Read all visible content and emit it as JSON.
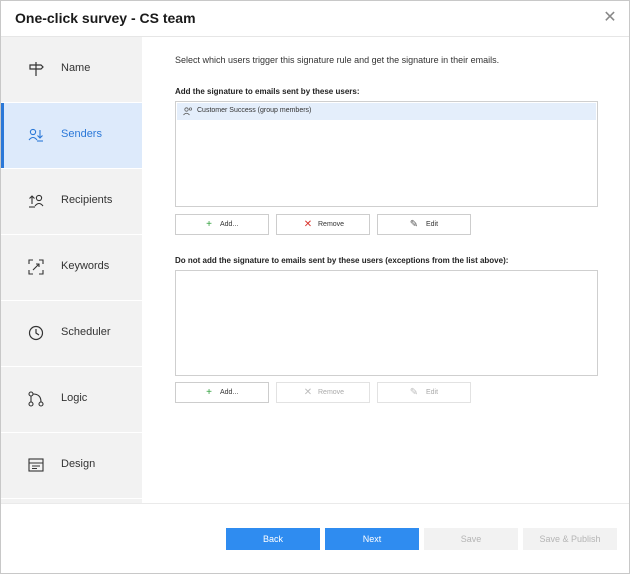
{
  "dialog": {
    "title": "One-click survey - CS team",
    "close_glyph": "✕"
  },
  "sidebar": {
    "items": [
      {
        "label": "Name",
        "icon": "signpost-icon",
        "active": false
      },
      {
        "label": "Senders",
        "icon": "users-icon",
        "active": true
      },
      {
        "label": "Recipients",
        "icon": "recipients-icon",
        "active": false
      },
      {
        "label": "Keywords",
        "icon": "keywords-icon",
        "active": false
      },
      {
        "label": "Scheduler",
        "icon": "clock-icon",
        "active": false
      },
      {
        "label": "Logic",
        "icon": "flow-icon",
        "active": false
      },
      {
        "label": "Design",
        "icon": "design-icon",
        "active": false
      }
    ]
  },
  "main": {
    "intro": "Select which users trigger this signature rule and get the signature in their emails.",
    "include": {
      "heading": "Add the signature to emails sent by these users:",
      "items": [
        "Customer Success (group members)"
      ],
      "buttons": {
        "add": "Add...",
        "remove": "Remove",
        "edit": "Edit"
      }
    },
    "exclude": {
      "heading": "Do not add the signature to emails sent by these users (exceptions from the list above):",
      "items": [],
      "buttons": {
        "add": "Add...",
        "remove": "Remove",
        "edit": "Edit"
      }
    }
  },
  "footer": {
    "back": "Back",
    "next": "Next",
    "save": "Save",
    "save_publish": "Save & Publish"
  },
  "colors": {
    "accent": "#2f8cf0",
    "active_nav_bg": "#ddeafb",
    "add_green": "#2e9e3a",
    "remove_red": "#d9322b"
  }
}
